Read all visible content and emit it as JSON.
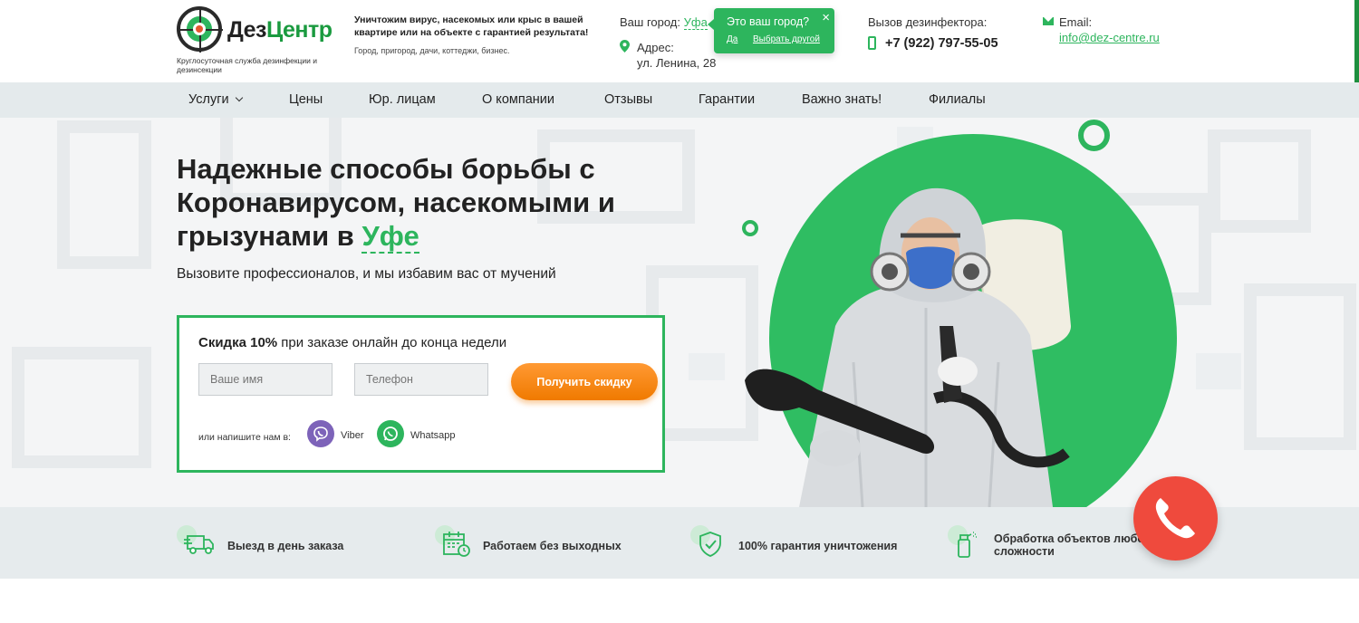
{
  "header": {
    "logo_name_a": "Дез",
    "logo_name_b": "Центр",
    "logo_sub": "Круглосуточная служба дезинфекции и дезинсекции",
    "tagline": "Уничтожим вирус, насекомых или крыс в вашей квартире или на объекте с гарантией результата!",
    "tagline_sub": "Город, пригород, дачи, коттеджи, бизнес.",
    "city_label": "Ваш город:",
    "city_value": "Уфа",
    "address_label": "Адрес:",
    "address_value": "ул. Ленина, 28",
    "call_label": "Вызов дезинфектора:",
    "phone": "+7 (922) 797-55-05",
    "email_label": "Email:",
    "email": "info@dez-centre.ru"
  },
  "city_popup": {
    "question": "Это ваш город?",
    "close": "×",
    "yes": "Да",
    "other": "Выбрать другой"
  },
  "nav": {
    "items": [
      "Услуги",
      "Цены",
      "Юр. лицам",
      "О компании",
      "Отзывы",
      "Гарантии",
      "Важно знать!",
      "Филиалы"
    ]
  },
  "hero": {
    "title_part1": "Надежные способы борьбы с Коронавирусом, насекомыми и грызунами в ",
    "title_city": "Уфе",
    "subtitle": "Вызовите профессионалов, и мы избавим вас от мучений"
  },
  "form": {
    "title_bold": "Скидка 10%",
    "title_rest": " при заказе онлайн до конца недели",
    "name_placeholder": "Ваше имя",
    "phone_placeholder": "Телефон",
    "submit": "Получить скидку",
    "write_us": "или напишите нам в:",
    "viber": "Viber",
    "whatsapp": "Whatsapp"
  },
  "features": [
    {
      "text": "Выезд в день заказа",
      "icon": "delivery-truck-icon"
    },
    {
      "text": "Работаем без выходных",
      "icon": "calendar-icon"
    },
    {
      "text": "100% гарантия уничтожения",
      "icon": "shield-check-icon"
    },
    {
      "text": "Обработка объектов любой сложности",
      "icon": "spray-bottle-icon"
    }
  ],
  "colors": {
    "brand_green": "#2db55d",
    "accent_orange": "#f07a00",
    "call_red": "#ef4a3d",
    "viber_purple": "#7d63b9"
  }
}
